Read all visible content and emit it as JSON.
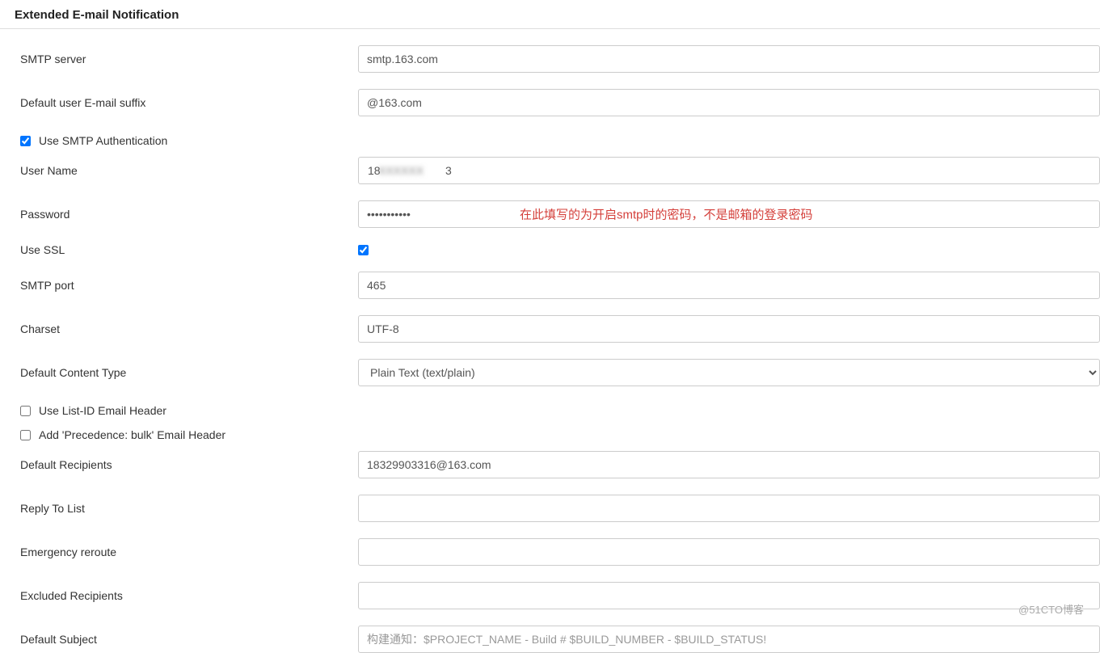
{
  "section": {
    "title": "Extended E-mail Notification"
  },
  "fields": {
    "smtp_server": {
      "label": "SMTP server",
      "value": "smtp.163.com"
    },
    "email_suffix": {
      "label": "Default user E-mail suffix",
      "value": "@163.com"
    },
    "use_smtp_auth": {
      "label": "Use SMTP Authentication",
      "checked": true
    },
    "username": {
      "label": "User Name",
      "value_prefix": "18",
      "value_blurred": "XXXXXX",
      "value_suffix": "3"
    },
    "password": {
      "label": "Password",
      "value": "•••••••••••",
      "annotation": "在此填写的为开启smtp时的密码，不是邮箱的登录密码"
    },
    "use_ssl": {
      "label": "Use SSL",
      "checked": true
    },
    "smtp_port": {
      "label": "SMTP port",
      "value": "465"
    },
    "charset": {
      "label": "Charset",
      "value": "UTF-8"
    },
    "content_type": {
      "label": "Default Content Type",
      "selected": "Plain Text (text/plain)"
    },
    "use_list_id": {
      "label": "Use List-ID Email Header",
      "checked": false
    },
    "precedence_bulk": {
      "label": "Add 'Precedence: bulk' Email Header",
      "checked": false
    },
    "default_recipients": {
      "label": "Default Recipients",
      "value": "18329903316@163.com"
    },
    "reply_to": {
      "label": "Reply To List",
      "value": ""
    },
    "emergency_reroute": {
      "label": "Emergency reroute",
      "value": ""
    },
    "excluded_recipients": {
      "label": "Excluded Recipients",
      "value": ""
    },
    "default_subject": {
      "label": "Default Subject",
      "value": "构建通知：$PROJECT_NAME - Build # $BUILD_NUMBER - $BUILD_STATUS!"
    }
  },
  "watermark": "@51CTO博客"
}
